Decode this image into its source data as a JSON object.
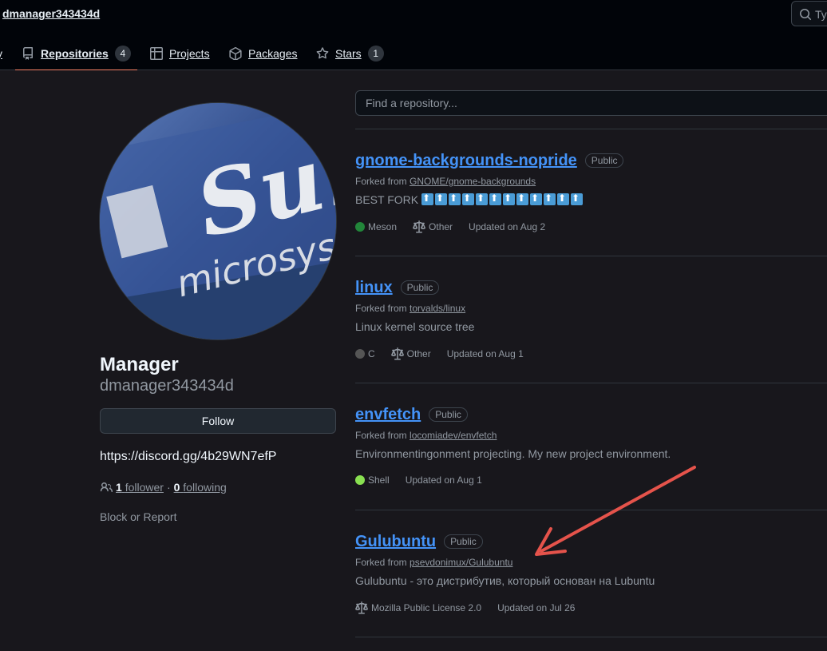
{
  "header": {
    "username": "dmanager343434d",
    "search_placeholder": "Ty"
  },
  "nav": {
    "partial_label": "y",
    "repositories": {
      "label": "Repositories",
      "count": "4"
    },
    "projects": {
      "label": "Projects"
    },
    "packages": {
      "label": "Packages"
    },
    "stars": {
      "label": "Stars",
      "count": "1"
    }
  },
  "profile": {
    "name": "Manager",
    "login": "dmanager343434d",
    "follow_label": "Follow",
    "link": "https://discord.gg/4b29WN7efP",
    "followers_count": "1",
    "followers_label": "follower",
    "following_count": "0",
    "following_label": "following",
    "separator": "·",
    "block_report": "Block or Report",
    "avatar_text_sun": "Sun",
    "avatar_text_micro": "microsys"
  },
  "repo_search": {
    "placeholder": "Find a repository..."
  },
  "repos": [
    {
      "name": "gnome-backgrounds-nopride",
      "visibility": "Public",
      "forked_prefix": "Forked from",
      "forked_from": "GNOME/gnome-backgrounds",
      "description": "BEST FORK",
      "language": "Meson",
      "language_color": "#22863a",
      "license": "Other",
      "updated": "Updated on Aug 2"
    },
    {
      "name": "linux",
      "visibility": "Public",
      "forked_prefix": "Forked from",
      "forked_from": "torvalds/linux",
      "description": "Linux kernel source tree",
      "language": "C",
      "language_color": "#555555",
      "license": "Other",
      "updated": "Updated on Aug 1"
    },
    {
      "name": "envfetch",
      "visibility": "Public",
      "forked_prefix": "Forked from",
      "forked_from": "locomiadev/envfetch",
      "description": "Environmentingonment projecting. My new project environment.",
      "language": "Shell",
      "language_color": "#89e051",
      "updated": "Updated on Aug 1"
    },
    {
      "name": "Gulubuntu",
      "visibility": "Public",
      "forked_prefix": "Forked from",
      "forked_from": "psevdonimux/Gulubuntu",
      "description": "Gulubuntu - это дистрибутив, который основан на Lubuntu",
      "license": "Mozilla Public License 2.0",
      "updated": "Updated on Jul 26"
    }
  ],
  "colors": {
    "accent_underline": "#f78166",
    "link": "#4493f8",
    "annotation_arrow": "#e5534b"
  }
}
